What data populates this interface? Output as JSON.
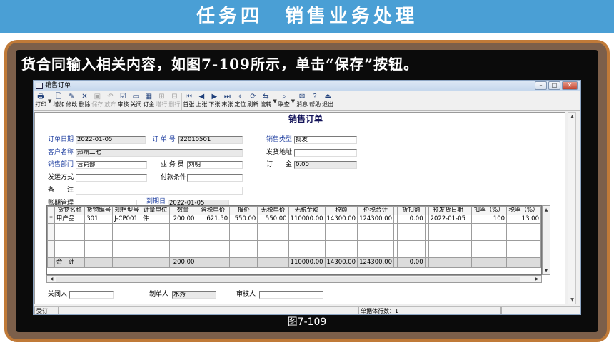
{
  "slide": {
    "title": "任务四　销售业务处理",
    "instruction": "货合同输入相关内容，如图7-109所示，单击“保存”按钮。",
    "caption": "图7-109"
  },
  "window": {
    "title": "销售订单",
    "controls": [
      "–",
      "□",
      "✕"
    ]
  },
  "toolbar": [
    {
      "id": "print",
      "label": "打印",
      "icon": "printer-icon",
      "glyph": "🖶",
      "enabled": true,
      "dropdown": true
    },
    {
      "id": "add",
      "label": "增加",
      "icon": "add-doc-icon",
      "glyph": "🗋",
      "enabled": true
    },
    {
      "id": "edit",
      "label": "修改",
      "icon": "edit-icon",
      "glyph": "✎",
      "enabled": true
    },
    {
      "id": "delete",
      "label": "删除",
      "icon": "delete-icon",
      "glyph": "✕",
      "enabled": true
    },
    {
      "id": "save",
      "label": "保存",
      "icon": "save-icon",
      "glyph": "▣",
      "enabled": false
    },
    {
      "id": "abandon",
      "label": "放弃",
      "icon": "undo-icon",
      "glyph": "↶",
      "enabled": false
    },
    {
      "id": "approve",
      "label": "审核",
      "icon": "approve-icon",
      "glyph": "☑",
      "enabled": true
    },
    {
      "id": "close",
      "label": "关闭",
      "icon": "folder-icon",
      "glyph": "▭",
      "enabled": true
    },
    {
      "id": "deposit",
      "label": "订金",
      "icon": "deposit-icon",
      "glyph": "▦",
      "enabled": true
    },
    {
      "id": "add-row",
      "label": "增行",
      "icon": "add-row-icon",
      "glyph": "⊞",
      "enabled": false
    },
    {
      "id": "delete-row",
      "label": "删行",
      "icon": "delete-row-icon",
      "glyph": "⊟",
      "enabled": false
    },
    {
      "id": "first",
      "label": "首张",
      "icon": "first-icon",
      "glyph": "⏮",
      "enabled": true,
      "sep": true
    },
    {
      "id": "prev",
      "label": "上张",
      "icon": "prev-icon",
      "glyph": "◀",
      "enabled": true
    },
    {
      "id": "next",
      "label": "下张",
      "icon": "next-icon",
      "glyph": "▶",
      "enabled": true
    },
    {
      "id": "last",
      "label": "末张",
      "icon": "last-icon",
      "glyph": "⏭",
      "enabled": true
    },
    {
      "id": "locate",
      "label": "定位",
      "icon": "locate-icon",
      "glyph": "⌖",
      "enabled": true
    },
    {
      "id": "refresh",
      "label": "刷新",
      "icon": "refresh-icon",
      "glyph": "⟳",
      "enabled": true
    },
    {
      "id": "flow",
      "label": "流转",
      "icon": "flow-icon",
      "glyph": "⇆",
      "enabled": true,
      "dropdown": true
    },
    {
      "id": "link",
      "label": "联查",
      "icon": "link-icon",
      "glyph": "⌕",
      "enabled": true,
      "dropdown": true
    },
    {
      "id": "message",
      "label": "消息",
      "icon": "message-icon",
      "glyph": "✉",
      "enabled": true
    },
    {
      "id": "help",
      "label": "帮助",
      "icon": "help-icon",
      "glyph": "?",
      "enabled": true
    },
    {
      "id": "exit",
      "label": "退出",
      "icon": "exit-icon",
      "glyph": "⏏",
      "enabled": true
    }
  ],
  "form": {
    "title": "销售订单",
    "order_date_label": "订单日期",
    "order_date": "2022-01-05",
    "order_no_label": "订 单 号",
    "order_no": "22010501",
    "sales_type_label": "销售类型",
    "sales_type": "批发",
    "customer_label": "客户名称",
    "customer": "郑州二七",
    "ship_addr_label": "发货地址",
    "ship_addr": "",
    "dept_label": "销售部门",
    "dept": "营销部",
    "salesman_label": "业 务 员",
    "salesman": "刘明",
    "deposit_label": "订　　金",
    "deposit": "0.00",
    "ship_method_label": "发运方式",
    "ship_method": "",
    "pay_terms_label": "付款条件",
    "pay_terms": "",
    "remark_label": "备　　注",
    "remark": "",
    "account_label": "账期管理",
    "account": "",
    "due_date_label": "到期日",
    "due_date": "2022-01-05",
    "closer_label": "关闭人",
    "closer": "",
    "maker_label": "制单人",
    "maker": "水秀",
    "auditor_label": "审核人",
    "auditor": ""
  },
  "grid": {
    "columns": [
      "",
      "货物名称",
      "货物编号",
      "规格型号",
      "计量单位",
      "数量",
      "含税单价",
      "报价",
      "无税单价",
      "无税金额",
      "税额",
      "价税合计",
      "",
      "折扣额",
      "",
      "预发货日期",
      "",
      "扣率（%）",
      "税率（%）"
    ],
    "rows": [
      [
        "*",
        "甲产品",
        "301",
        "J-CP001",
        "件",
        "200.00",
        "621.50",
        "550.00",
        "550.00",
        "110000.00",
        "14300.00",
        "124300.00",
        "",
        "0.00",
        "",
        "2022-01-05",
        "",
        "100",
        "13.00"
      ]
    ],
    "blank_rows": 4,
    "total": [
      "",
      "合　计",
      "",
      "",
      "",
      "200.00",
      "",
      "",
      "",
      "110000.00",
      "14300.00",
      "124300.00",
      "",
      "0.00",
      "",
      "",
      "",
      "",
      ""
    ]
  },
  "status": {
    "left": "受订",
    "rows": "单据体行数：1"
  }
}
